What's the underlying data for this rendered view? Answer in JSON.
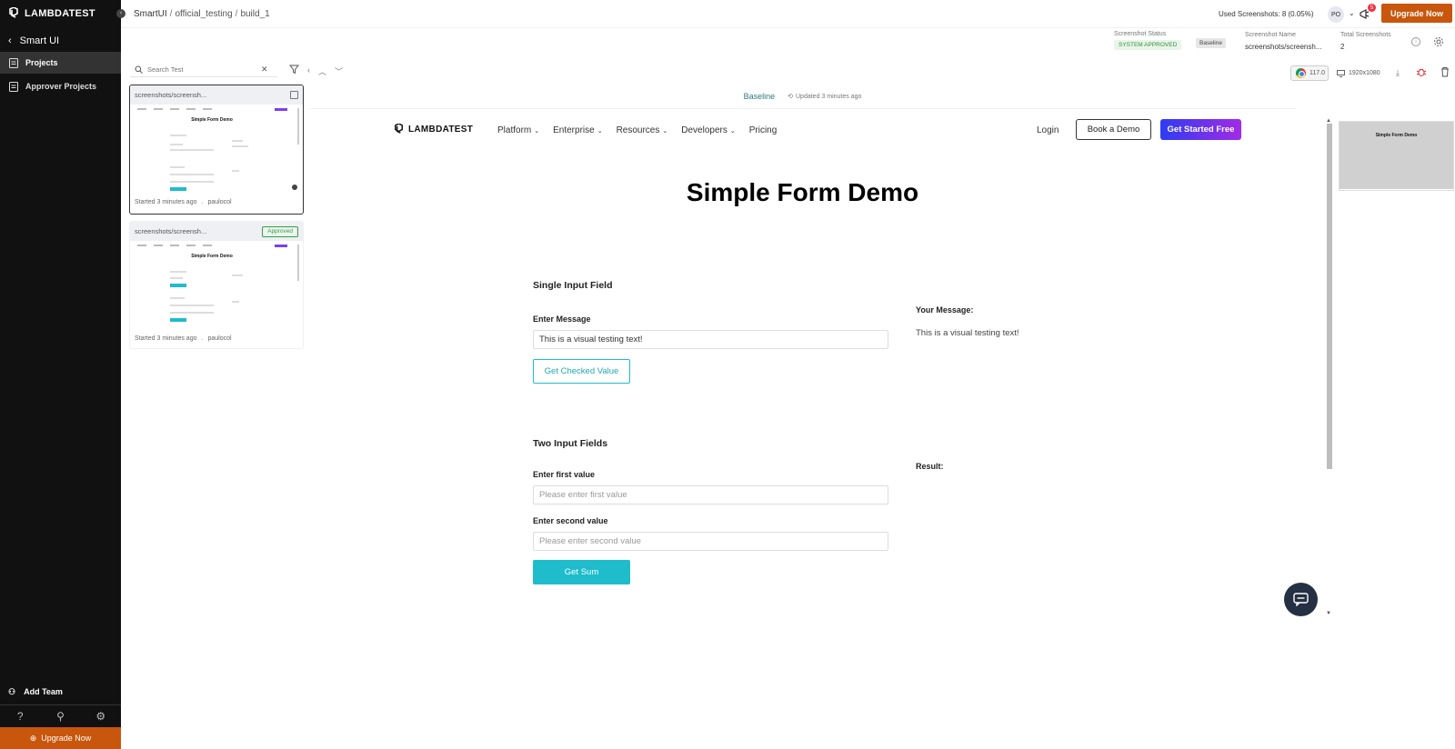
{
  "app": {
    "logo_text": "LAMBDATEST"
  },
  "sidebar": {
    "back_label": "Smart UI",
    "items": [
      {
        "label": "Projects",
        "active": true
      },
      {
        "label": "Approver Projects",
        "active": false
      }
    ],
    "add_team": "Add Team",
    "upgrade": "Upgrade Now"
  },
  "header": {
    "breadcrumb": {
      "root": "SmartUI",
      "project": "official_testing",
      "build": "build_1"
    },
    "used_screenshots": "Used Screenshots: 8 (0.05%)",
    "avatar": "PO",
    "notif_count": "5",
    "upgrade": "Upgrade Now",
    "status": {
      "label": "Screenshot Status",
      "value": "SYSTEM APPROVED"
    },
    "baseline": "Baseline",
    "name": {
      "label": "Screenshot Name",
      "value": "screenshots/screensh..."
    },
    "total": {
      "label": "Total Screenshots",
      "value": "2"
    }
  },
  "toolbar": {
    "search_placeholder": "Search Test",
    "browser_version": "117.0",
    "resolution": "1920x1080"
  },
  "shots": [
    {
      "name": "screenshots/screensh...",
      "status": "",
      "started": "Started 3 minutes ago",
      "user": "paulocol",
      "thumb_title": "Simple Form Demo"
    },
    {
      "name": "screenshots/screensh...",
      "status": "Approved",
      "started": "Started 3 minutes ago",
      "user": "paulocol",
      "thumb_title": "Simple Form Demo"
    }
  ],
  "viewer": {
    "baseline_label": "Baseline",
    "updated": "Updated 3 minutes ago"
  },
  "page": {
    "logo": "LAMBDATEST",
    "menu": [
      "Platform",
      "Enterprise",
      "Resources",
      "Developers",
      "Pricing"
    ],
    "login": "Login",
    "book_demo": "Book a Demo",
    "get_started": "Get Started Free",
    "title": "Simple Form Demo",
    "single": {
      "title": "Single Input Field",
      "label": "Enter Message",
      "value": "This is a visual testing text!",
      "button": "Get Checked Value",
      "out_label": "Your Message:",
      "out_value": "This is a visual testing text!"
    },
    "two": {
      "title": "Two Input Fields",
      "label1": "Enter first value",
      "ph1": "Please enter first value",
      "label2": "Enter second value",
      "ph2": "Please enter second value",
      "button": "Get Sum",
      "result_label": "Result:"
    }
  },
  "minimap": {
    "title": "Simple Form Demo"
  },
  "colors": {
    "accent": "#1fbccc",
    "upgrade": "#c8560c",
    "sidebar": "#111111"
  }
}
